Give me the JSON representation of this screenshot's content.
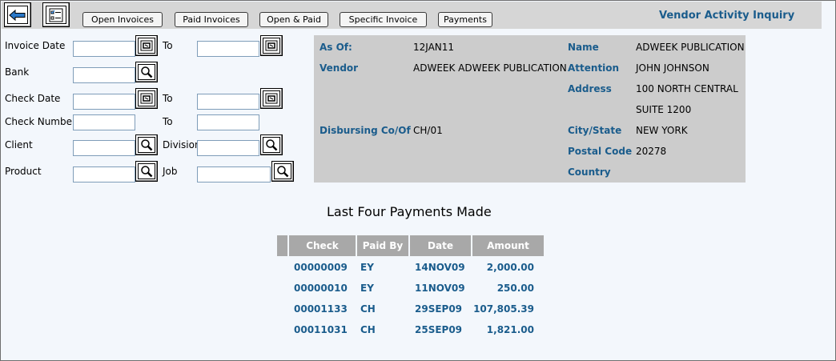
{
  "toolbar": {
    "buttons": [
      "Open Invoices",
      "Paid Invoices",
      "Open & Paid",
      "Specific Invoice",
      "Payments"
    ],
    "title": "Vendor Activity Inquiry",
    "icons": [
      "back-arrow-icon",
      "checklist-icon"
    ]
  },
  "form": {
    "invoice_date": "Invoice Date",
    "to": "To",
    "bank": "Bank",
    "check_date": "Check Date",
    "check_number": "Check Number",
    "client": "Client",
    "division": "Division",
    "product": "Product",
    "job": "Job"
  },
  "info": {
    "as_of_label": "As Of:",
    "as_of": "12JAN11",
    "vendor_label": "Vendor",
    "vendor": "ADWEEK ADWEEK PUBLICATION",
    "disbursing_label": "Disbursing Co/Of",
    "disbursing": "CH/01",
    "name_label": "Name",
    "name": "ADWEEK PUBLICATION",
    "attention_label": "Attention",
    "attention": "JOHN JOHNSON",
    "address_label": "Address",
    "address1": "100 NORTH CENTRAL",
    "address2": "SUITE 1200",
    "city_label": "City/State",
    "city": "NEW YORK",
    "postal_label": "Postal Code",
    "postal": "20278",
    "country_label": "Country"
  },
  "payments": {
    "title": "Last Four Payments Made",
    "columns": [
      "Check",
      "Paid By",
      "Date",
      "Amount"
    ],
    "rows": [
      {
        "check": "00000009",
        "paid_by": "EY",
        "date": "14NOV09",
        "amount": "2,000.00"
      },
      {
        "check": "00000010",
        "paid_by": "EY",
        "date": "11NOV09",
        "amount": "250.00"
      },
      {
        "check": "00001133",
        "paid_by": "CH",
        "date": "29SEP09",
        "amount": "107,805.39"
      },
      {
        "check": "00011031",
        "paid_by": "CH",
        "date": "25SEP09",
        "amount": "1,821.00"
      }
    ]
  },
  "colors": {
    "accent": "#1a5c8c",
    "panel": "#cccccc",
    "header": "#a8a8a8"
  }
}
